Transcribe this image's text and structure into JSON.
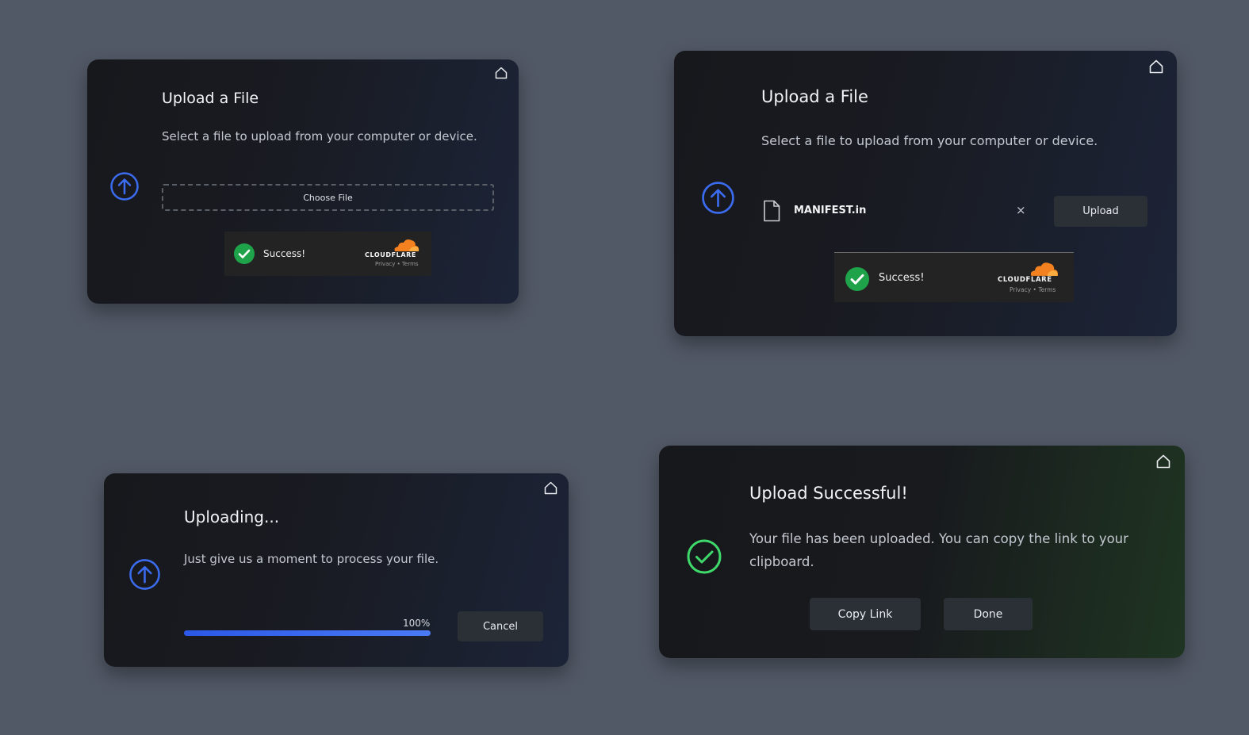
{
  "colors": {
    "background": "#525966",
    "accent_blue": "#3b6cf0",
    "success_green": "#3fd96b",
    "cloudflare_orange": "#f48120"
  },
  "card1": {
    "title": "Upload a File",
    "description": "Select a file to upload from your computer or device.",
    "choose_file_label": "Choose File",
    "turnstile": {
      "status": "Success!",
      "brand": "CLOUDFLARE",
      "links": "Privacy • Terms"
    }
  },
  "card2": {
    "title": "Upload a File",
    "description": "Select a file to upload from your computer or device.",
    "file_name": "MANIFEST.in",
    "remove_label": "×",
    "upload_label": "Upload",
    "turnstile": {
      "status": "Success!",
      "brand": "CLOUDFLARE",
      "links": "Privacy • Terms"
    }
  },
  "card3": {
    "title": "Uploading...",
    "description": "Just give us a moment to process your file.",
    "progress_percent": 100,
    "progress_label": "100%",
    "cancel_label": "Cancel"
  },
  "card4": {
    "title": "Upload Successful!",
    "description_line1": "Your file has been uploaded. You can copy the link to your",
    "description_line2": "clipboard.",
    "copy_label": "Copy Link",
    "done_label": "Done"
  },
  "icons": {
    "home": "home-icon",
    "upload": "upload-arrow-circle-icon",
    "file": "file-icon",
    "success": "check-circle-icon",
    "cloudflare": "cloudflare-cloud-icon"
  }
}
